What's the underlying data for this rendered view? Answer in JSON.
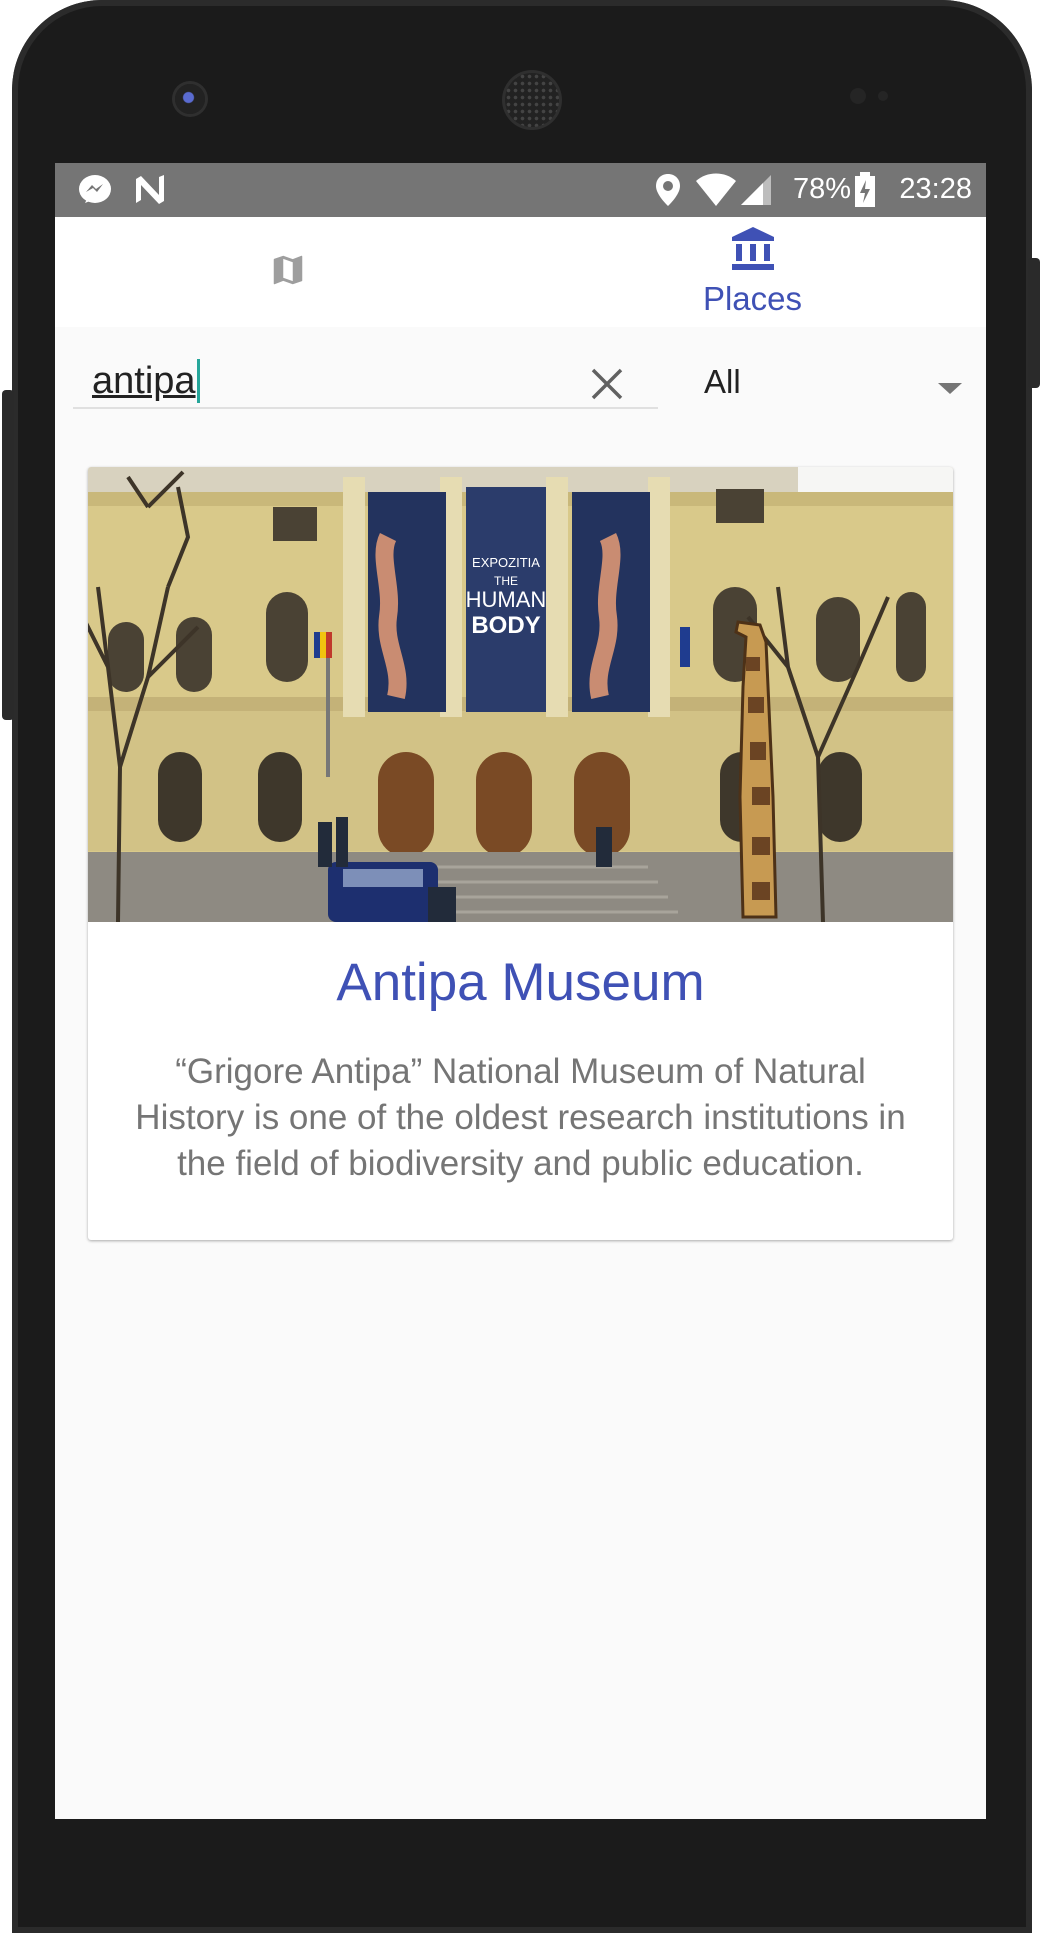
{
  "status_bar": {
    "notification_icons": [
      "messenger-icon",
      "n-app-icon"
    ],
    "system_icons": [
      "location-icon",
      "wifi-icon",
      "signal-icon",
      "battery-charging-icon"
    ],
    "battery": "78%",
    "time": "23:28"
  },
  "tabs": [
    {
      "icon": "map-icon",
      "label": "",
      "selected": false
    },
    {
      "icon": "museum-icon",
      "label": "Places",
      "selected": true
    }
  ],
  "search": {
    "value": "antipa",
    "clear_icon": "close-icon"
  },
  "filter": {
    "selected": "All",
    "caret_icon": "dropdown-arrow-icon"
  },
  "results": [
    {
      "title": "Antipa Museum",
      "description": "“Grigore Antipa” National Museum of Natural History is one of the oldest research institutions in the field of biodiversity and public education.",
      "image": "museum-facade-photo",
      "banner_text": [
        "EXPOZITIA",
        "THE",
        "HUMAN",
        "BODY"
      ]
    }
  ],
  "colors": {
    "accent": "#3f51b5",
    "status_bar": "#757575",
    "cursor": "#26a69a",
    "description_text": "#757575",
    "background": "#fafafa"
  }
}
